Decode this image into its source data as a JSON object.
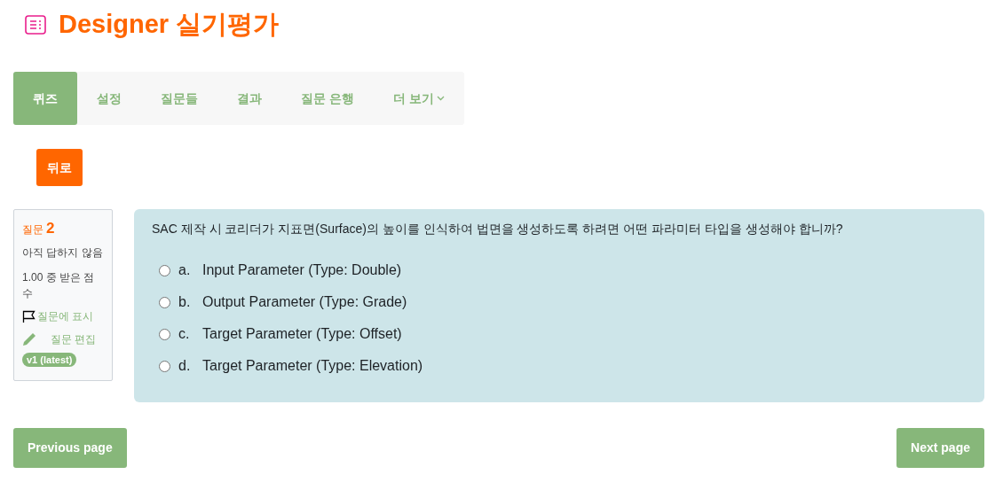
{
  "title": "Designer 실기평가",
  "tabs": [
    {
      "label": "퀴즈",
      "selected": true
    },
    {
      "label": "설정",
      "selected": false
    },
    {
      "label": "질문들",
      "selected": false
    },
    {
      "label": "결과",
      "selected": false
    },
    {
      "label": "질문 은행",
      "selected": false
    },
    {
      "label": "더 보기",
      "selected": false,
      "dropdown": true
    }
  ],
  "back_button": "뒤로",
  "question_info": {
    "label": "질문",
    "number": "2",
    "status": "아직 답하지 않음",
    "mark": "1.00 중 받은 점수",
    "flag": "질문에 표시",
    "edit": "질문 편집",
    "version": "v1 (latest)"
  },
  "question": {
    "text": "SAC 제작 시 코리더가 지표면(Surface)의 높이를 인식하여 법면을 생성하도록 하려면 어떤 파라미터 타입을 생성해야 합니까?",
    "options": [
      {
        "letter": "a.",
        "text": "Input Parameter (Type: Double)",
        "selected": false
      },
      {
        "letter": "b.",
        "text": "Output Parameter (Type: Grade)",
        "selected": false
      },
      {
        "letter": "c.",
        "text": "Target Parameter (Type: Offset)",
        "selected": false
      },
      {
        "letter": "d.",
        "text": "Target Parameter (Type: Elevation)",
        "selected": false
      }
    ]
  },
  "previous_button": "Previous page",
  "next_button": "Next page"
}
